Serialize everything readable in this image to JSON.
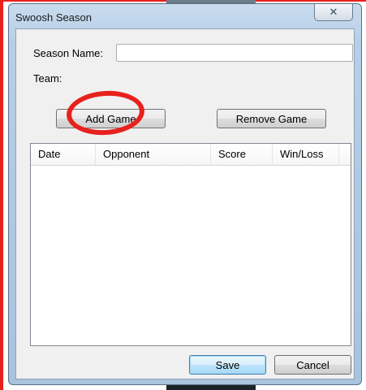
{
  "window": {
    "title": "Swoosh Season",
    "close_glyph": "✕"
  },
  "form": {
    "season_name_label": "Season Name:",
    "season_name_value": "",
    "team_label": "Team:"
  },
  "buttons": {
    "add_game": "Add Game",
    "remove_game": "Remove Game",
    "save": "Save",
    "cancel": "Cancel"
  },
  "games_table": {
    "columns": [
      "Date",
      "Opponent",
      "Score",
      "Win/Loss"
    ],
    "rows": []
  },
  "annotation": {
    "shape": "circle",
    "color": "#e8211d",
    "highlights": "add-game-button"
  }
}
